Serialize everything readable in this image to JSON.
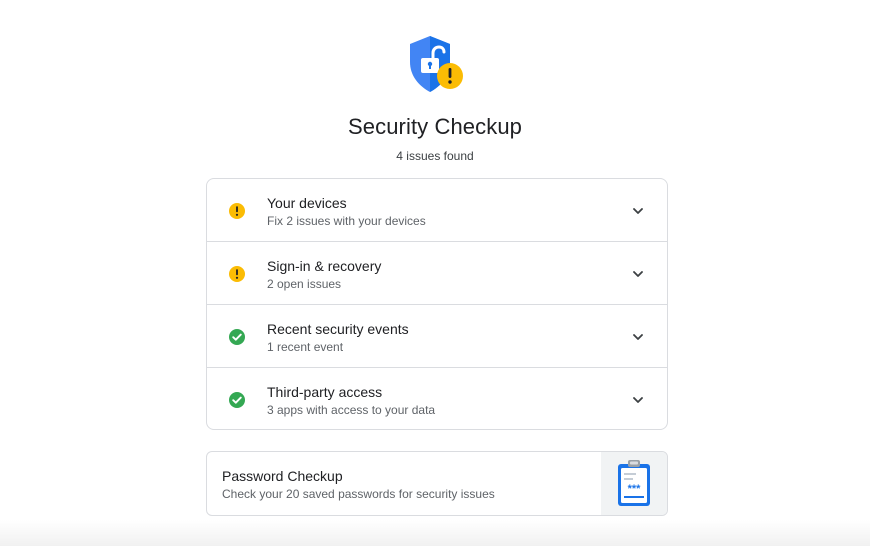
{
  "header": {
    "title": "Security Checkup",
    "subtitle": "4 issues found",
    "icon": "shield-unlocked-warning-icon"
  },
  "colors": {
    "shield_blue": "#4285f4",
    "shield_dark": "#1a73e8",
    "warning_yellow": "#fbbc04",
    "success_green": "#34a853",
    "border": "#dadce0",
    "text_primary": "#202124",
    "text_secondary": "#5f6368"
  },
  "issues": [
    {
      "title": "Your devices",
      "description": "Fix 2 issues with your devices",
      "status": "warning",
      "icon": "warning-circle-icon"
    },
    {
      "title": "Sign-in & recovery",
      "description": "2 open issues",
      "status": "warning",
      "icon": "warning-circle-icon"
    },
    {
      "title": "Recent security events",
      "description": "1 recent event",
      "status": "ok",
      "icon": "check-circle-icon"
    },
    {
      "title": "Third-party access",
      "description": "3 apps with access to your data",
      "status": "ok",
      "icon": "check-circle-icon"
    }
  ],
  "password_checkup": {
    "title": "Password Checkup",
    "description": "Check your 20 saved passwords for security issues",
    "icon": "clipboard-password-icon"
  }
}
